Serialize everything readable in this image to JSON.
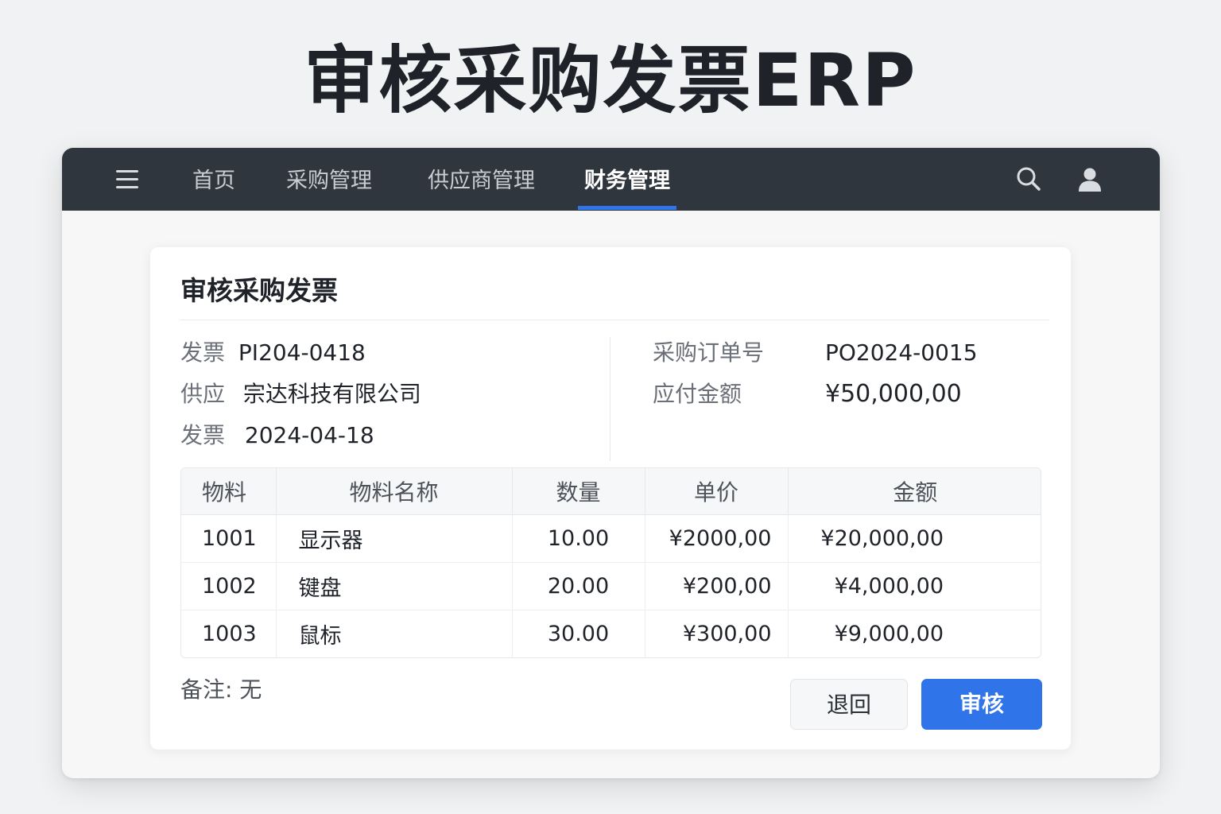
{
  "page": {
    "title": "审核采购发票ERP"
  },
  "nav": {
    "items": [
      {
        "label": "首页"
      },
      {
        "label": "采购管理"
      },
      {
        "label": "供应商管理"
      },
      {
        "label": "财务管理"
      }
    ],
    "active_index": 3,
    "icons": {
      "menu": "menu-icon",
      "search": "search-icon",
      "user": "user-icon"
    }
  },
  "invoice": {
    "title": "审核采购发票",
    "left_fields": [
      {
        "label": "发票",
        "value": "PI204-0418"
      },
      {
        "label": "供应",
        "value": "宗达科技有限公司"
      },
      {
        "label": "发票",
        "value": "2024-04-18"
      }
    ],
    "right_fields": [
      {
        "label": "采购订单号",
        "value": "PO2024-0015"
      },
      {
        "label": "应付金额",
        "value": "¥50,000,00"
      }
    ]
  },
  "table": {
    "headers": [
      "物料",
      "物料名称",
      "数量",
      "单价",
      "金额"
    ],
    "rows": [
      [
        "1001",
        "显示器",
        "10.00",
        "¥2000,00",
        "¥20,000,00"
      ],
      [
        "1002",
        "键盘",
        "20.00",
        "¥200,00",
        "¥4,000,00"
      ],
      [
        "1003",
        "鼠标",
        "30.00",
        "¥300,00",
        "¥9,000,00"
      ]
    ]
  },
  "remark": "备注: 无",
  "actions": {
    "return_label": "退回",
    "approve_label": "审核"
  },
  "colors": {
    "navbar": "#30363d",
    "accent": "#2f74e8",
    "background": "#f1f2f3"
  }
}
